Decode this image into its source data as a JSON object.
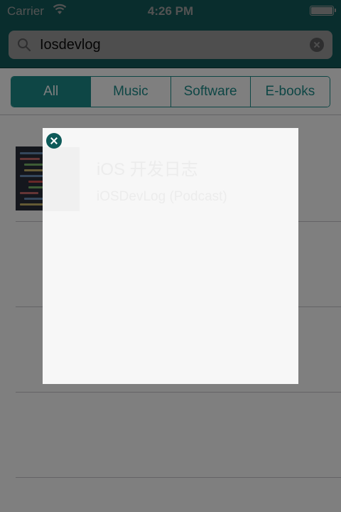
{
  "status_bar": {
    "carrier": "Carrier",
    "time": "4:26 PM",
    "wifi_icon": "wifi-icon",
    "battery_icon": "battery-icon"
  },
  "search": {
    "value": "Iosdevlog",
    "search_icon": "magnifier-icon",
    "clear_icon": "clear-x-icon"
  },
  "scopes": {
    "items": [
      "All",
      "Music",
      "Software",
      "E-books"
    ],
    "selected": "All"
  },
  "results": [
    {
      "title": "iOS 开发日志",
      "subtitle": "iOSDevLog (Podcast)"
    },
    {
      "title": "",
      "subtitle": ""
    },
    {
      "title": "",
      "subtitle": ""
    },
    {
      "title": "",
      "subtitle": ""
    }
  ],
  "popup": {
    "close_icon": "close-x-icon"
  },
  "colors": {
    "accent": "#1d8d8b",
    "accent_dark": "#0e5a59",
    "overlay": "rgba(0,0,0,0.5)",
    "popup_background": "#f7f7f7"
  }
}
